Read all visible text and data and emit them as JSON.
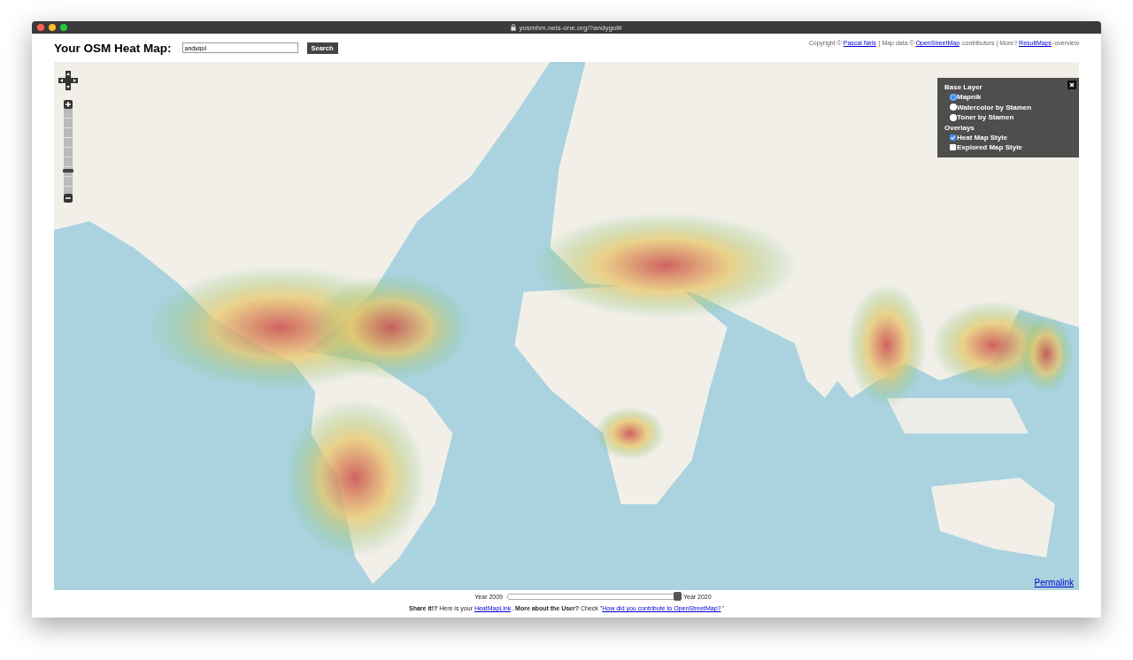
{
  "browser": {
    "url": "yosmhm.neis-one.org/?andygol#"
  },
  "header": {
    "title": "Your OSM Heat Map:",
    "search": {
      "value": "andygol"
    },
    "search_button": "Search",
    "copyright": [
      {
        "kind": "text",
        "text": "Copyright © "
      },
      {
        "kind": "link",
        "text": "Pascal Neis"
      },
      {
        "kind": "text",
        "text": " | Map data © "
      },
      {
        "kind": "link",
        "text": "OpenStreetMap"
      },
      {
        "kind": "text",
        "text": " contributors | More? "
      },
      {
        "kind": "link",
        "text": "ResultMaps"
      },
      {
        "kind": "text",
        "text": "-overview"
      }
    ]
  },
  "map": {
    "zoom": {
      "level": 0.27
    },
    "permalink": "Permalink",
    "layers": {
      "base_title": "Base Layer",
      "base": [
        {
          "label": "Mapnik",
          "selected": true
        },
        {
          "label": "Watercolor by Stamen",
          "selected": false
        },
        {
          "label": "Toner by Stamen",
          "selected": false
        }
      ],
      "overlay_title": "Overlays",
      "overlays": [
        {
          "label": "Heat Map Style",
          "checked": true
        },
        {
          "label": "Explored Map Style",
          "checked": false
        }
      ]
    }
  },
  "years": {
    "start": "Year 2009",
    "end": "Year 2020",
    "level": 1
  },
  "share": [
    {
      "kind": "text",
      "text": "**Share it!?** Here is your "
    },
    {
      "kind": "link",
      "text": "HeatMapLink"
    },
    {
      "kind": "text",
      "text": ". **More about the User?** Check \""
    },
    {
      "kind": "link",
      "text": "How did you contribute to OpenStreetMap?"
    },
    {
      "kind": "text",
      "text": "\""
    }
  ]
}
